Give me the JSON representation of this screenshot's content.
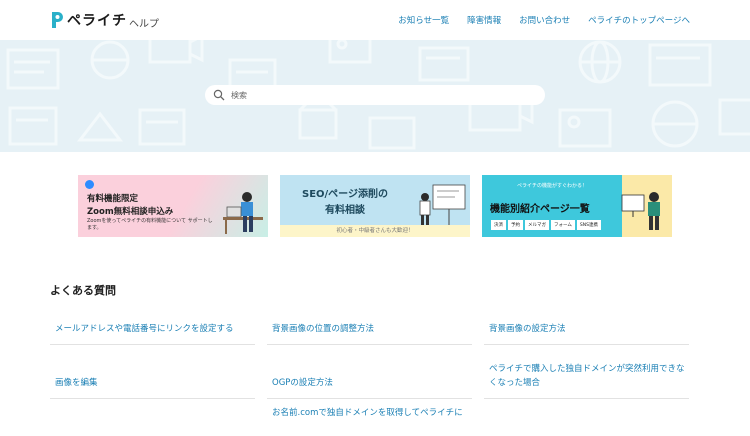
{
  "header": {
    "logo_text": "ペライチ",
    "logo_sub": "ヘルプ",
    "nav": [
      "お知らせ一覧",
      "障害情報",
      "お問い合わせ",
      "ペライチのトップページへ"
    ]
  },
  "search": {
    "placeholder": "検索"
  },
  "banners": {
    "zoom": {
      "title1": "有料機能限定",
      "title2": "Zoom無料相談申込み",
      "desc": "Zoomを使ってペライチの有料機能について サポートします。"
    },
    "seo": {
      "title1": "SEO/ページ添削の",
      "title2": "有料相談",
      "footer": "初心者・中級者さんも大歓迎！"
    },
    "features": {
      "top": "ペライチの機能がすぐわかる！",
      "title": "機能別紹介ページ一覧",
      "tags": [
        "決済",
        "予約",
        "メルマガ",
        "フォーム",
        "SNS連携"
      ]
    }
  },
  "faq": {
    "title": "よくある質問",
    "items": [
      "メールアドレスや電話番号にリンクを設定する",
      "背景画像の位置の調整方法",
      "背景画像の設定方法",
      "画像を編集",
      "OGPの設定方法",
      "ペライチで購入した独自ドメインが突然利用できなくなった場合",
      "お名前.comで独自ドメインを取得してペライチに"
    ]
  },
  "colors": {
    "link": "#1a7fb4",
    "hero_bg": "#e6f1f6",
    "brand": "#2ab0c9"
  }
}
